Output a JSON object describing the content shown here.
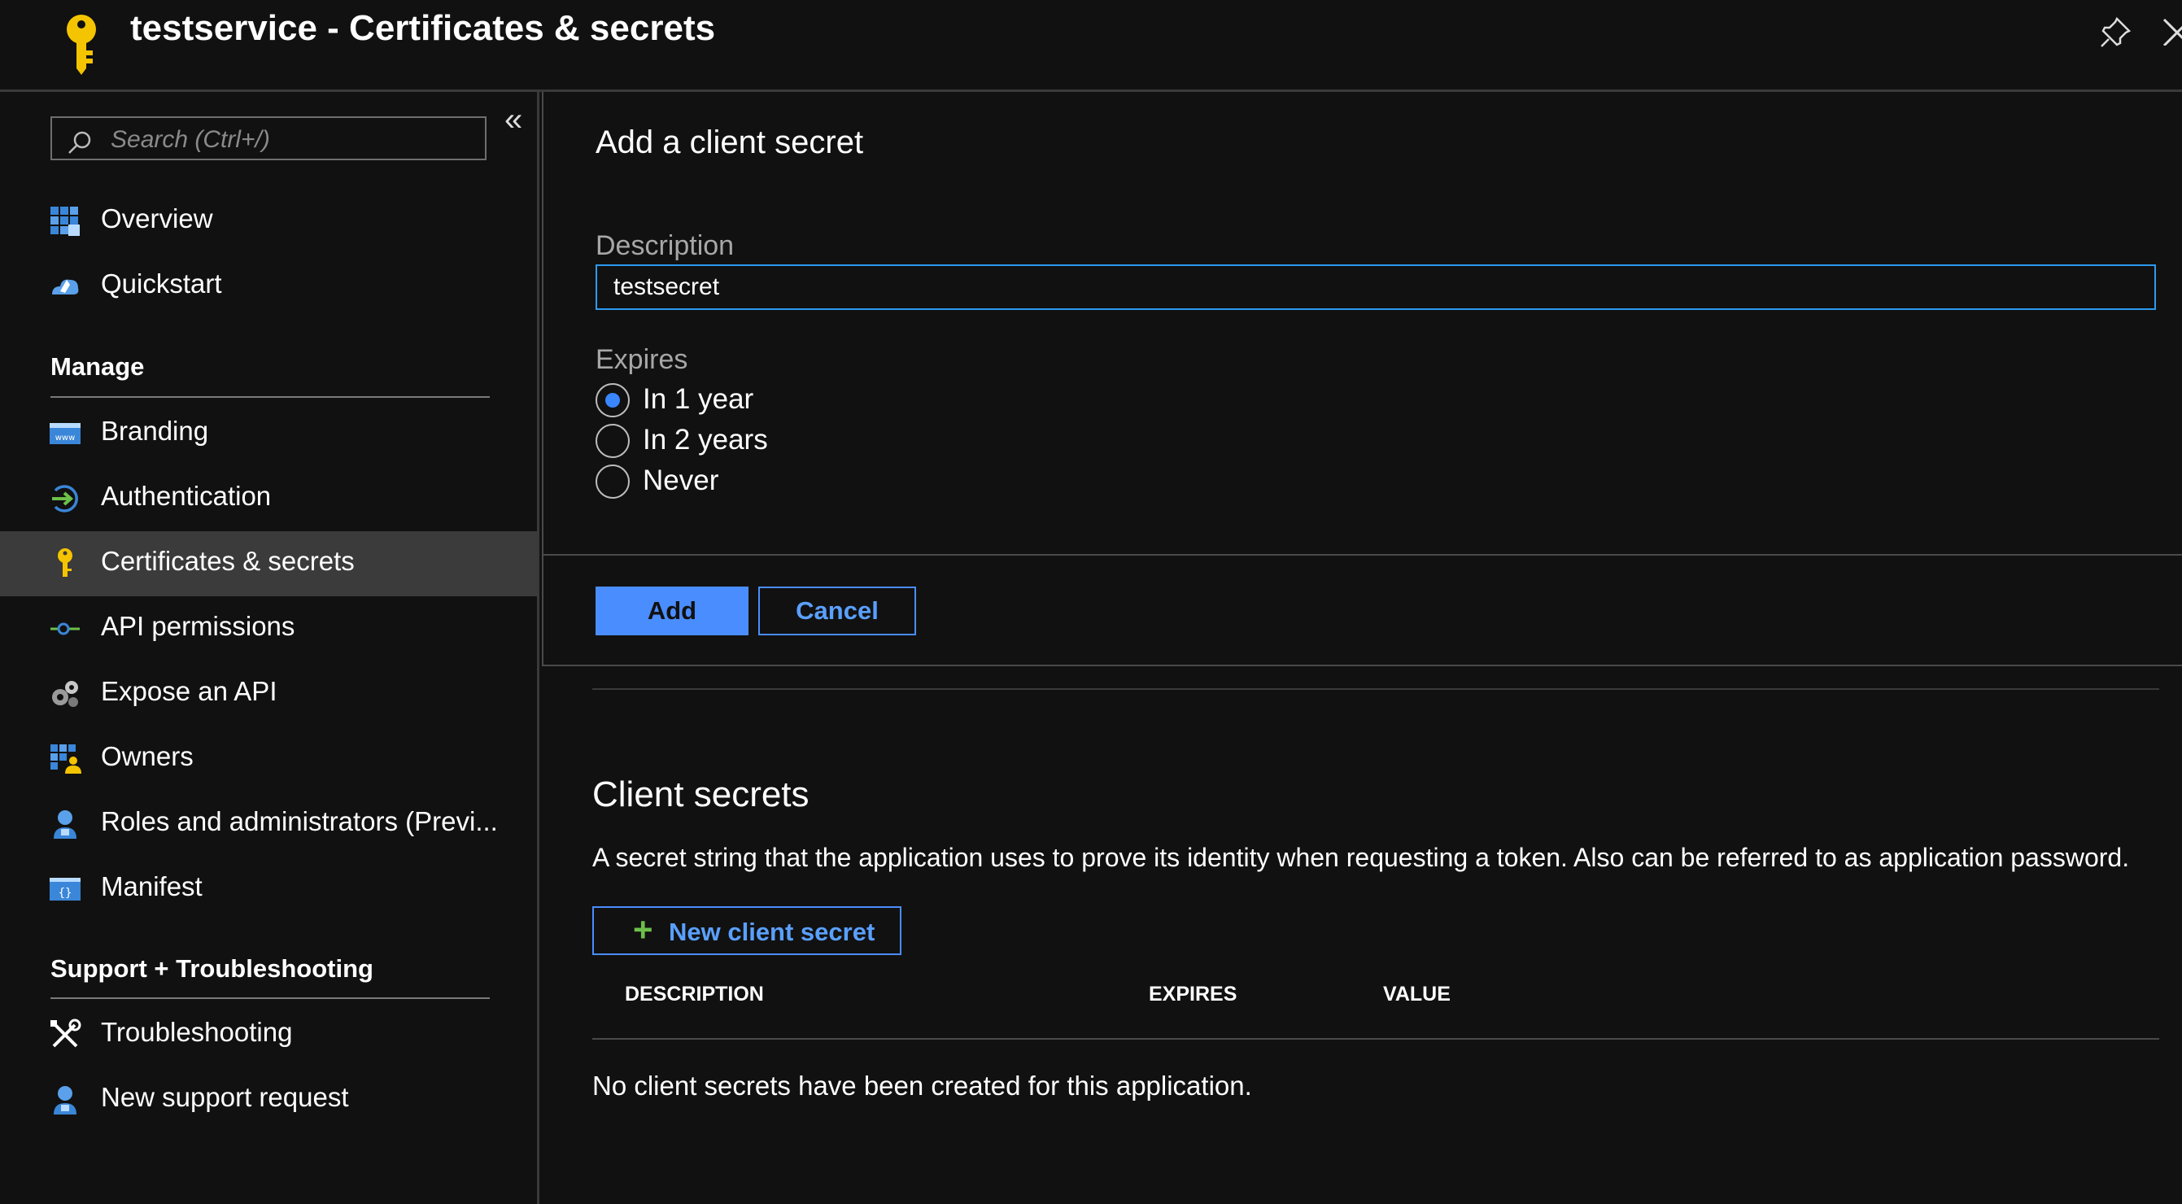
{
  "header": {
    "title": "testservice - Certificates & secrets",
    "icon": "key-icon",
    "accent": "#f5c400"
  },
  "sidebar": {
    "search": {
      "placeholder": "Search (Ctrl+/)",
      "value": ""
    },
    "top_items": [
      {
        "label": "Overview",
        "icon": "overview-icon"
      },
      {
        "label": "Quickstart",
        "icon": "quickstart-icon"
      }
    ],
    "manage": {
      "heading": "Manage",
      "items": [
        {
          "label": "Branding",
          "icon": "branding-icon"
        },
        {
          "label": "Authentication",
          "icon": "authentication-icon"
        },
        {
          "label": "Certificates & secrets",
          "icon": "key-icon",
          "active": true
        },
        {
          "label": "API permissions",
          "icon": "api-permissions-icon"
        },
        {
          "label": "Expose an API",
          "icon": "expose-api-icon"
        },
        {
          "label": "Owners",
          "icon": "owners-icon"
        },
        {
          "label": "Roles and administrators (Previ...",
          "icon": "roles-icon"
        },
        {
          "label": "Manifest",
          "icon": "manifest-icon"
        }
      ]
    },
    "support": {
      "heading": "Support + Troubleshooting",
      "items": [
        {
          "label": "Troubleshooting",
          "icon": "troubleshooting-icon"
        },
        {
          "label": "New support request",
          "icon": "support-request-icon"
        }
      ]
    }
  },
  "add_secret": {
    "title": "Add a client secret",
    "description_label": "Description",
    "description_value": "testsecret",
    "expires_label": "Expires",
    "options": [
      "In 1 year",
      "In 2 years",
      "Never"
    ],
    "selected_option": "In 1 year",
    "add_label": "Add",
    "cancel_label": "Cancel"
  },
  "client_secrets": {
    "title": "Client secrets",
    "description": "A secret string that the application uses to prove its identity when requesting a token. Also can be referred to as application password.",
    "new_button": "New client secret",
    "columns": [
      "DESCRIPTION",
      "EXPIRES",
      "VALUE"
    ],
    "empty_message": "No client secrets have been created for this application."
  },
  "colors": {
    "background": "#111111",
    "primary": "#4a8dff",
    "active_item": "#3b3b3b",
    "input_border": "#2d9bf0"
  }
}
